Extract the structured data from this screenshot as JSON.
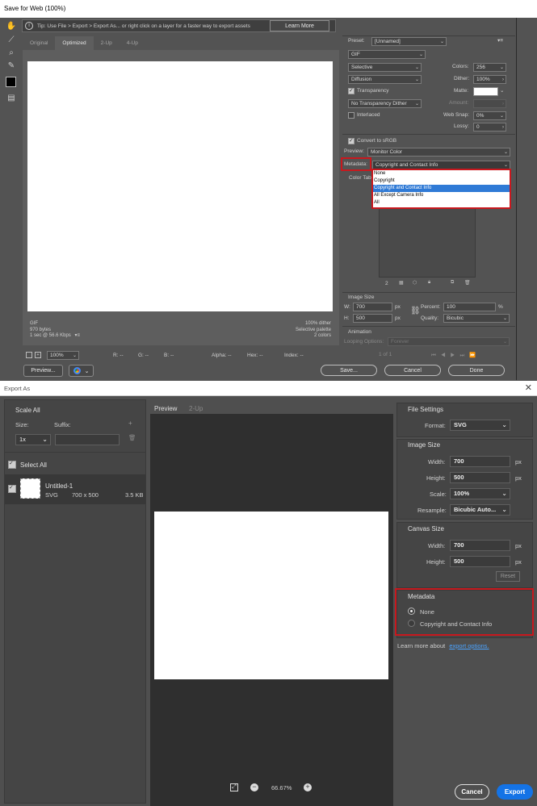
{
  "sfw": {
    "title": "Save for Web (100%)",
    "tip": "Tip: Use File > Export > Export As... or right click on a layer for a faster way to export assets",
    "learn_more": "Learn More",
    "tabs": [
      "Original",
      "Optimized",
      "2-Up",
      "4-Up"
    ],
    "info_left": [
      "GIF",
      "970 bytes",
      "1 sec @ 56.6 Kbps"
    ],
    "info_left_menu": "▾≡",
    "info_right": [
      "100% dither",
      "Selective palette",
      "2 colors"
    ],
    "status": {
      "zoom": "100%",
      "r": "R: --",
      "g": "G: --",
      "b": "B: --",
      "alpha": "Alpha: --",
      "hex": "Hex: --",
      "index": "Index: --"
    },
    "preview_btn": "Preview...",
    "save_btn": "Save...",
    "cancel_btn": "Cancel",
    "done_btn": "Done",
    "preset_label": "Preset:",
    "preset_value": "[Unnamed]",
    "format_value": "GIF",
    "reduction_value": "Selective",
    "dither_algo": "Diffusion",
    "colors_label": "Colors:",
    "colors_value": "256",
    "dither_label": "Dither:",
    "dither_value": "100%",
    "matte_label": "Matte:",
    "transparency_label": "Transparency",
    "transparency_dither": "No Transparency Dither",
    "amount_label": "Amount:",
    "interlaced_label": "Interlaced",
    "websnap_label": "Web Snap:",
    "websnap_value": "0%",
    "lossy_label": "Lossy:",
    "lossy_value": "0",
    "convert_label": "Convert to sRGB",
    "preview_label": "Preview:",
    "preview_value": "Monitor Color",
    "metadata_label": "Metadata:",
    "metadata_value": "Copyright and Contact Info",
    "metadata_options": [
      "None",
      "Copyright",
      "Copyright and Contact Info",
      "All Except Camera Info",
      "All"
    ],
    "color_table_label": "Color Tab",
    "color_count": "2",
    "image_size_label": "Image Size",
    "w_label": "W:",
    "w_value": "700",
    "h_label": "H:",
    "h_value": "500",
    "px": "px",
    "percent_label": "Percent:",
    "percent_value": "100",
    "percent_unit": "%",
    "quality_label": "Quality:",
    "quality_value": "Bicubic",
    "animation_label": "Animation",
    "looping_label": "Looping Options:",
    "looping_value": "Forever",
    "frame_counter": "1 of 1"
  },
  "export": {
    "title": "Export As",
    "scale_all": "Scale All",
    "size_label": "Size:",
    "suffix_label": "Suffix:",
    "size_value": "1x",
    "select_all": "Select All",
    "item_name": "Untitled-1",
    "item_format": "SVG",
    "item_dims": "700 x 500",
    "item_size": "3.5 KB",
    "preview_tab": "Preview",
    "twoup_tab": "2-Up",
    "zoom": "66.67%",
    "file_settings": "File Settings",
    "format_label": "Format:",
    "format_value": "SVG",
    "image_size": "Image Size",
    "width_label": "Width:",
    "width_value": "700",
    "height_label": "Height:",
    "height_value": "500",
    "px": "px",
    "scale_label": "Scale:",
    "scale_value": "100%",
    "resample_label": "Resample:",
    "resample_value": "Bicubic Auto...",
    "canvas_size": "Canvas Size",
    "canvas_width": "700",
    "canvas_height": "500",
    "reset": "Reset",
    "metadata": "Metadata",
    "meta_none": "None",
    "meta_copyright": "Copyright and Contact Info",
    "learn_more_prefix": "Learn more about",
    "learn_more_link": "export options.",
    "cancel": "Cancel",
    "export": "Export"
  },
  "colors": {
    "highlight_red": "#c8181e",
    "selection_blue": "#2f7ad6",
    "export_blue": "#1473e6"
  }
}
